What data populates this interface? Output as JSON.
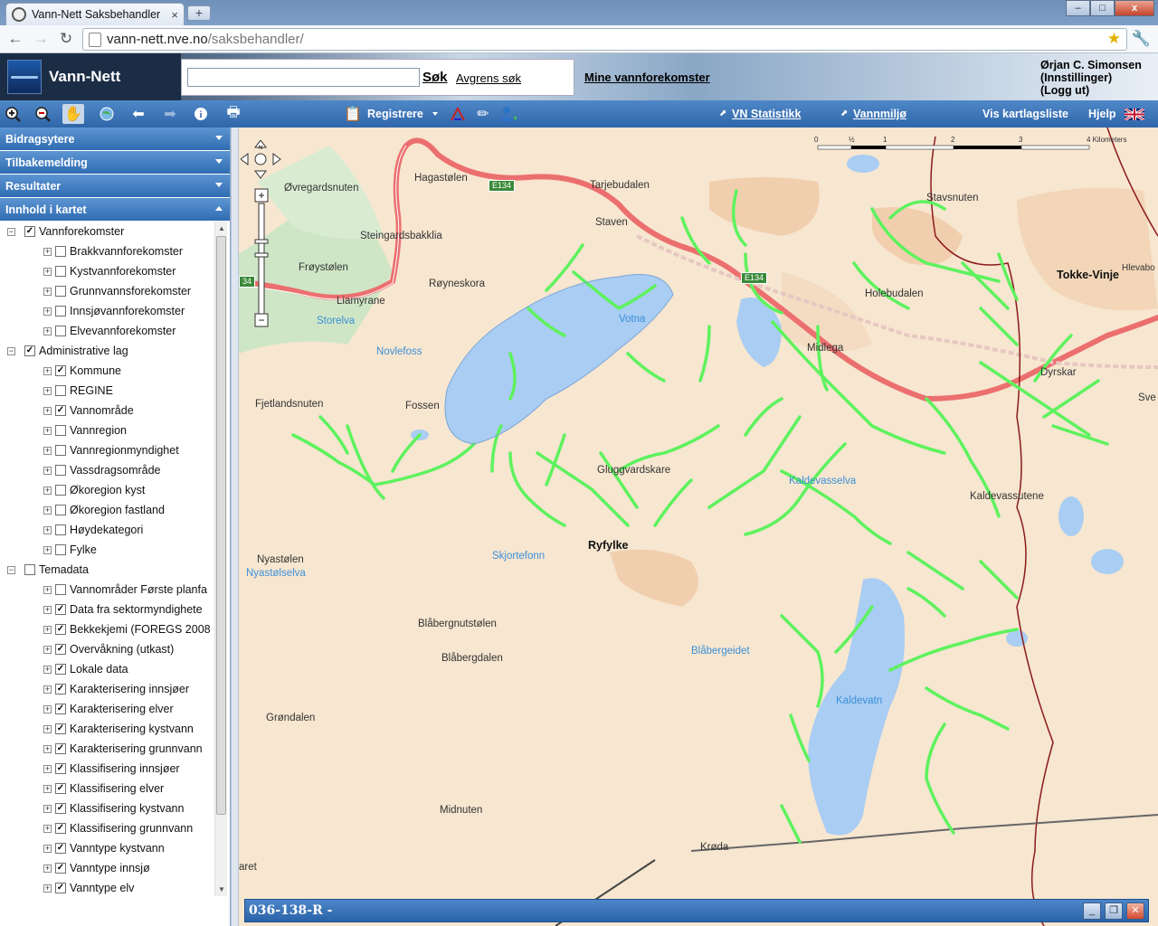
{
  "browser": {
    "tab_title": "Vann-Nett Saksbehandler",
    "tab_close": "×",
    "newtab": "+",
    "url_host": "vann-nett.nve.no",
    "url_path": "/saksbehandler/",
    "win_min": "–",
    "win_max": "□",
    "win_close": "x"
  },
  "header": {
    "app_name": "Vann-Nett",
    "search_placeholder": "",
    "search_button": "Søk",
    "refine_link": "Avgrens søk",
    "my_waters_link": "Mine vannforekomster",
    "user_name": "Ørjan C. Simonsen",
    "user_settings": "(Innstillinger)",
    "user_logout": "(Logg ut)"
  },
  "maptoolbar": {
    "register_label": "Registrere",
    "stats_link": "VN Statistikk",
    "env_link": "Vannmiljø",
    "layers_link": "Vis kartlagsliste",
    "help_link": "Hjelp"
  },
  "leftpanel": {
    "sections": [
      {
        "label": "Bidragsytere",
        "expanded": false
      },
      {
        "label": "Tilbakemelding",
        "expanded": false
      },
      {
        "label": "Resultater",
        "expanded": false
      },
      {
        "label": "Innhold i kartet",
        "expanded": true
      }
    ],
    "tree": [
      {
        "level": 0,
        "label": "Vannforekomster",
        "checked": true,
        "exp": "−"
      },
      {
        "level": 1,
        "label": "Brakkvannforekomster",
        "checked": false,
        "exp": "+"
      },
      {
        "level": 1,
        "label": "Kystvannforekomster",
        "checked": false,
        "exp": "+"
      },
      {
        "level": 1,
        "label": "Grunnvannsforekomster",
        "checked": false,
        "exp": "+"
      },
      {
        "level": 1,
        "label": "Innsjøvannforekomster",
        "checked": false,
        "exp": "+"
      },
      {
        "level": 1,
        "label": "Elvevannforekomster",
        "checked": false,
        "exp": "+"
      },
      {
        "level": 0,
        "label": "Administrative lag",
        "checked": true,
        "exp": "−"
      },
      {
        "level": 1,
        "label": "Kommune",
        "checked": true,
        "exp": "+"
      },
      {
        "level": 1,
        "label": "REGINE",
        "checked": false,
        "exp": "+"
      },
      {
        "level": 1,
        "label": "Vannområde",
        "checked": true,
        "exp": "+"
      },
      {
        "level": 1,
        "label": "Vannregion",
        "checked": false,
        "exp": "+"
      },
      {
        "level": 1,
        "label": "Vannregionmyndighet",
        "checked": false,
        "exp": "+"
      },
      {
        "level": 1,
        "label": "Vassdragsområde",
        "checked": false,
        "exp": "+"
      },
      {
        "level": 1,
        "label": "Økoregion kyst",
        "checked": false,
        "exp": "+"
      },
      {
        "level": 1,
        "label": "Økoregion fastland",
        "checked": false,
        "exp": "+"
      },
      {
        "level": 1,
        "label": "Høydekategori",
        "checked": false,
        "exp": "+"
      },
      {
        "level": 1,
        "label": "Fylke",
        "checked": false,
        "exp": "+"
      },
      {
        "level": 0,
        "label": "Temadata",
        "checked": false,
        "exp": "−"
      },
      {
        "level": 1,
        "label": "Vannområder Første planfa",
        "checked": false,
        "exp": "+"
      },
      {
        "level": 1,
        "label": "Data fra sektormyndighete",
        "checked": true,
        "exp": "+"
      },
      {
        "level": 1,
        "label": "Bekkekjemi (FOREGS 2008",
        "checked": true,
        "exp": "+"
      },
      {
        "level": 1,
        "label": "Overvåkning (utkast)",
        "checked": true,
        "exp": "+"
      },
      {
        "level": 1,
        "label": "Lokale data",
        "checked": true,
        "exp": "+"
      },
      {
        "level": 1,
        "label": "Karakterisering innsjøer",
        "checked": true,
        "exp": "+"
      },
      {
        "level": 1,
        "label": "Karakterisering elver",
        "checked": true,
        "exp": "+"
      },
      {
        "level": 1,
        "label": "Karakterisering kystvann",
        "checked": true,
        "exp": "+"
      },
      {
        "level": 1,
        "label": "Karakterisering grunnvann",
        "checked": true,
        "exp": "+"
      },
      {
        "level": 1,
        "label": "Klassifisering innsjøer",
        "checked": true,
        "exp": "+"
      },
      {
        "level": 1,
        "label": "Klassifisering elver",
        "checked": true,
        "exp": "+"
      },
      {
        "level": 1,
        "label": "Klassifisering kystvann",
        "checked": true,
        "exp": "+"
      },
      {
        "level": 1,
        "label": "Klassifisering grunnvann",
        "checked": true,
        "exp": "+"
      },
      {
        "level": 1,
        "label": "Vanntype kystvann",
        "checked": true,
        "exp": "+"
      },
      {
        "level": 1,
        "label": "Vanntype innsjø",
        "checked": true,
        "exp": "+"
      },
      {
        "level": 1,
        "label": "Vanntype elv",
        "checked": true,
        "exp": "+"
      }
    ]
  },
  "map": {
    "scale_labels": [
      "0",
      "½",
      "1",
      "2",
      "3",
      "4 Kilometers"
    ],
    "labels": {
      "hagastolen": "Hagastølen",
      "tarjebudalen": "Tarjebudalen",
      "ovregardsnuten": "Øvregardsnuten",
      "staven": "Staven",
      "stavsnuten": "Stavsnuten",
      "steingardsbakklia": "Steingardsbakklia",
      "froystolen": "Frøystølen",
      "royneskora": "Røyneskora",
      "liamyrane": "Liamyrane",
      "storelva": "Storelva",
      "votna": "Votna",
      "holebudalen": "Holebudalen",
      "tokke_vinje": "Tokke-Vinje",
      "hlevabo": "Hlevabo",
      "midlega": "Midlega",
      "novlefoss": "Novlefoss",
      "dyrskar": "Dyrskar",
      "fjetlandsnuten": "Fjetlandsnuten",
      "fossen": "Fossen",
      "sve": "Sve",
      "gluggvardskare": "Gluggvardskare",
      "kaldevasselva": "Kaldevasselva",
      "kaldevassutene": "Kaldevassutene",
      "ryfylke": "Ryfylke",
      "skjortefonn": "Skjortefonn",
      "nyastolen": "Nyastølen",
      "nyastolselva": "Nyastølselva",
      "blabergnutstolen": "Blåbergnutstølen",
      "blabergdalen": "Blåbergdalen",
      "blabergeidet": "Blåbergeidet",
      "kaldevatn": "Kaldevatn",
      "grondalen": "Grøndalen",
      "midnuten": "Midnuten",
      "kroda": "Krøda",
      "aret": "aret"
    },
    "road_e134": "E134",
    "road_34": "34",
    "colors": {
      "land": "#f7e6d0",
      "water": "#a9cdf3",
      "rivers_highlight": "#5ef25e",
      "road": "#ec6f6f"
    }
  },
  "bottom_panel": {
    "title": "036-138-R -"
  }
}
